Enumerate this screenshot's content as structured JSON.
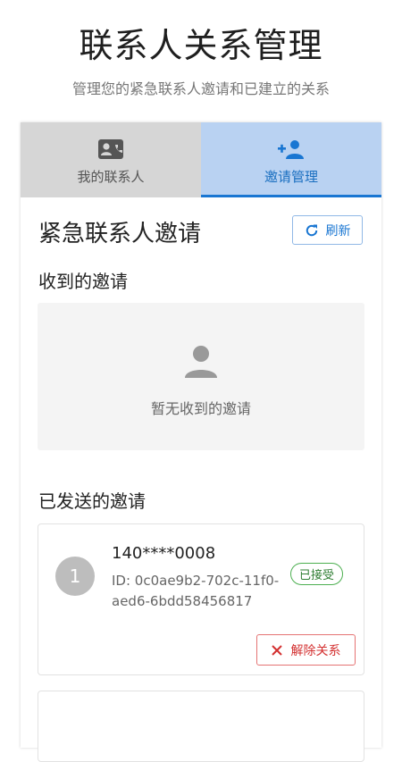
{
  "header": {
    "title": "联系人关系管理",
    "subtitle": "管理您的紧急联系人邀请和已建立的关系"
  },
  "tabs": [
    {
      "label": "我的联系人",
      "icon": "contact-card-icon",
      "active": false
    },
    {
      "label": "邀请管理",
      "icon": "person-add-icon",
      "active": true
    }
  ],
  "main": {
    "title": "紧急联系人邀请",
    "refresh_label": "刷新",
    "received": {
      "heading": "收到的邀请",
      "empty_text": "暂无收到的邀请",
      "empty_icon": "person-icon"
    },
    "sent": {
      "heading": "已发送的邀请",
      "items": [
        {
          "avatar": "1",
          "phone": "140****0008",
          "id": "ID: 0c0ae9b2-702c-11f0-aed6-6bdd58456817",
          "status": "已接受",
          "remove_label": "解除关系"
        }
      ]
    }
  },
  "colors": {
    "primary": "#1976d2",
    "active_tab_bg": "#b9d2f2",
    "inactive_tab_bg": "#d6d6d6",
    "success": "#2e7d32",
    "danger": "#d32f2f"
  }
}
